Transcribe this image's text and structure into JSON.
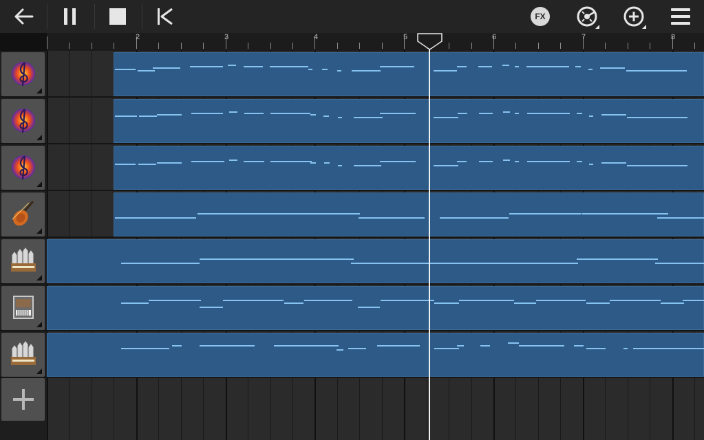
{
  "toolbar": {
    "back_icon": "arrow-left-icon",
    "pause_icon": "pause-icon",
    "stop_icon": "stop-icon",
    "rewind_icon": "skip-to-start-icon",
    "fx_label": "FX",
    "metronome_icon": "metronome-icon",
    "add_icon": "plus-circle-icon",
    "menu_icon": "hamburger-menu-icon"
  },
  "ruler": {
    "bar_numbers": [
      "2",
      "3",
      "4",
      "5",
      "6",
      "7",
      "8"
    ]
  },
  "tracks": [
    {
      "instrument": "treble-clef-synth-icon"
    },
    {
      "instrument": "treble-clef-synth-icon"
    },
    {
      "instrument": "treble-clef-synth-icon"
    },
    {
      "instrument": "violin-icon"
    },
    {
      "instrument": "organ-pipes-icon"
    },
    {
      "instrument": "keyboard-instrument-icon"
    },
    {
      "instrument": "organ-pipes-icon"
    }
  ],
  "add_track_icon": "plus-icon",
  "colors": {
    "clip": "#2e5a87",
    "note": "#86c3f1",
    "background": "#2b2b2b",
    "toolbar": "#242424",
    "playhead": "#f2f2f2"
  }
}
